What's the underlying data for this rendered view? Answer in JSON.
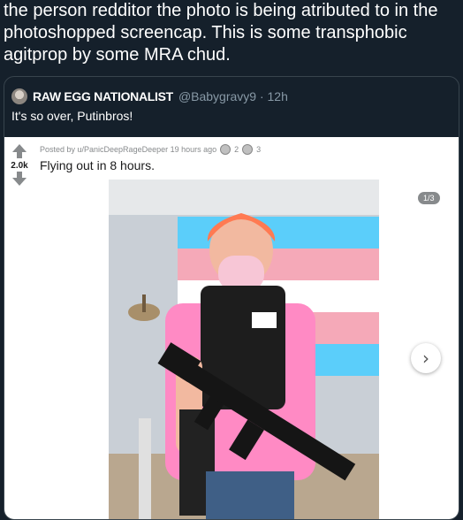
{
  "tweet": {
    "text": "the person redditor the photo is being atributed to in the photoshopped screencap. This is some transphobic agitprop by some MRA chud."
  },
  "quote": {
    "name": "RAW EGG NATIONALIST",
    "handle": "@Babygravy9 · 12h",
    "text": "It's so over, Putinbros!"
  },
  "reddit_post": {
    "score": "2.0k",
    "meta": "Posted by u/PanicDeepRageDeeper 19 hours ago",
    "award_count_1": "2",
    "award_count_2": "3",
    "title": "Flying out in 8 hours.",
    "gallery_counter": "1/3",
    "next_icon": "›"
  },
  "colors": {
    "background": "#15202b",
    "card_border": "#38444d",
    "handle_gray": "#8899a6",
    "flag_blue": "#5bcefa",
    "flag_pink": "#f5a9b8",
    "flag_white": "#ffffff"
  },
  "icons": [
    "avatar",
    "upvote-icon",
    "downvote-icon",
    "award-icon",
    "chevron-right-icon"
  ]
}
